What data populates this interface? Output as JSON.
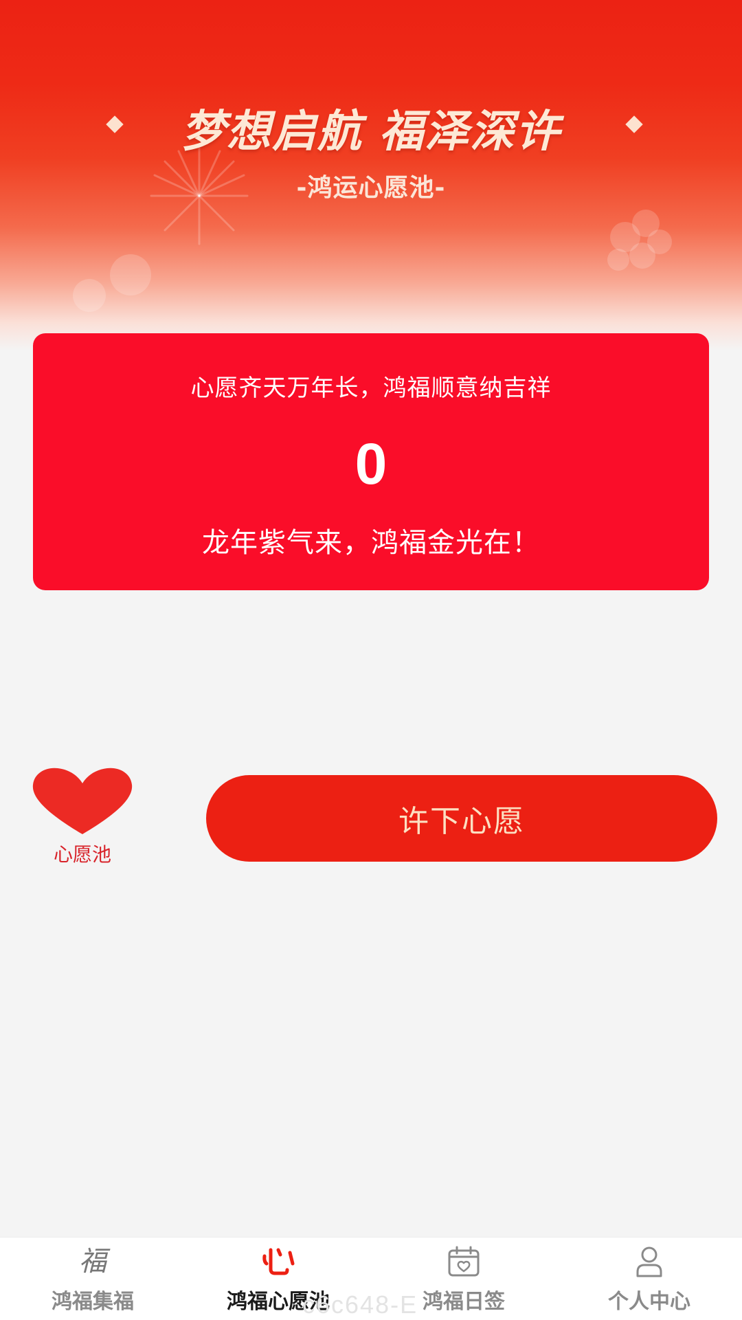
{
  "banner": {
    "headline": "梦想启航 福泽深许",
    "subtitle": "-鸿运心愿池-"
  },
  "stats_card": {
    "top_text": "心愿齐天万年长，鸿福顺意纳吉祥",
    "count": "0",
    "bottom_text": "龙年紫气来，鸿福金光在！"
  },
  "wish_pool": {
    "label": "心愿池",
    "icon": "heart-icon"
  },
  "make_wish": {
    "label": "许下心愿"
  },
  "tab_bar": {
    "tabs": [
      {
        "label": "鸿福集福",
        "icon": "fu-character-icon",
        "active": false
      },
      {
        "label": "鸿福心愿池",
        "icon": "heart-outline-icon",
        "active": true
      },
      {
        "label": "鸿福日签",
        "icon": "calendar-heart-icon",
        "active": false
      },
      {
        "label": "个人中心",
        "icon": "person-icon",
        "active": false
      }
    ]
  },
  "watermark": "c6c648-E",
  "colors": {
    "brand_red": "#ec2013",
    "card_red": "#fa0d29",
    "accent_gold": "#fce0c2",
    "page_bg": "#f4f4f4"
  }
}
